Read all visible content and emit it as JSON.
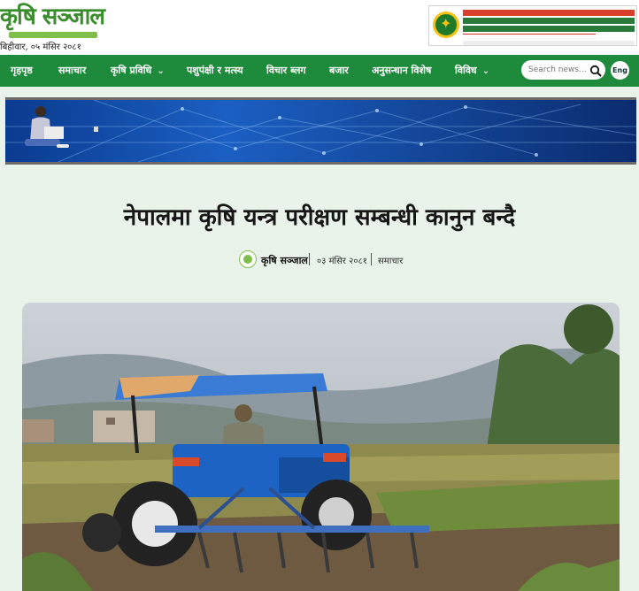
{
  "site": {
    "logo_text": "कृषि सञ्जाल",
    "date": "बिहीवार, ०५ मंसिर २०८१"
  },
  "nav": {
    "items": [
      {
        "label": "गृहपृष्ठ",
        "dropdown": false
      },
      {
        "label": "समाचार",
        "dropdown": false
      },
      {
        "label": "कृषि प्रविधि",
        "dropdown": true
      },
      {
        "label": "पशुपंक्षी र मत्स्य",
        "dropdown": false
      },
      {
        "label": "विचार ब्लग",
        "dropdown": false
      },
      {
        "label": "बजार",
        "dropdown": false
      },
      {
        "label": "अनुसन्धान विशेष",
        "dropdown": false
      },
      {
        "label": "विविध",
        "dropdown": true
      }
    ],
    "search_placeholder": "Search news...",
    "language_button": "Eng"
  },
  "article": {
    "title": "नेपालमा कृषि यन्त्र परीक्षण सम्बन्धी कानुन बन्दै",
    "author": "कृषि सञ्जाल",
    "date": "०३ मंसिर २०८१",
    "category": "समाचार"
  },
  "colors": {
    "brand_green": "#1e8a3c",
    "background": "#e9f3e9",
    "tractor_blue": "#1d63c4"
  },
  "icons": {
    "search": "search-icon",
    "dropdown": "chevron-down-icon"
  }
}
